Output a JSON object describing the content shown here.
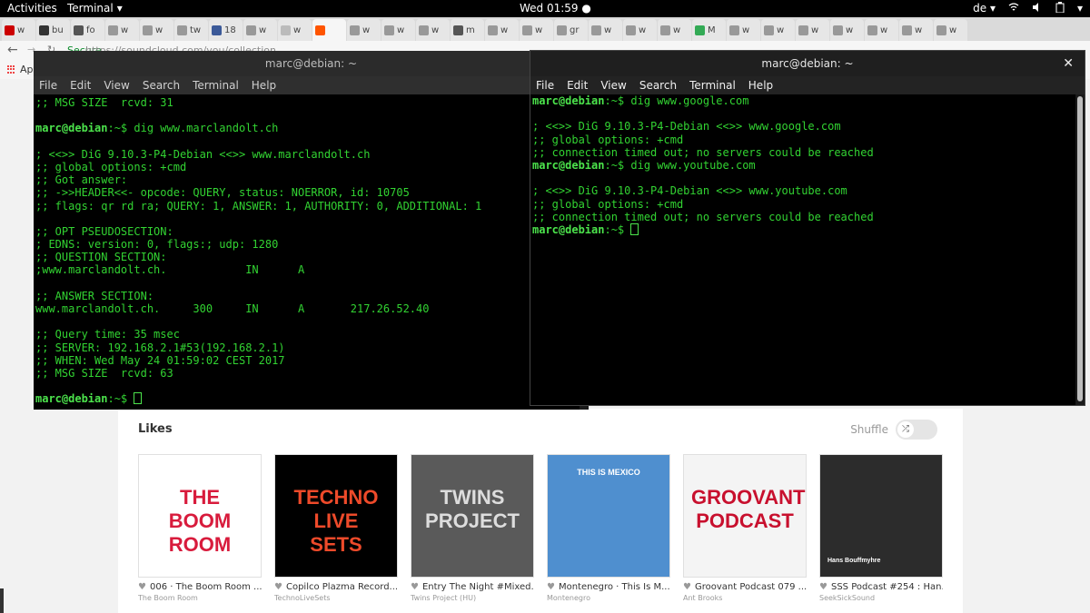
{
  "topbar": {
    "activities": "Activities",
    "app": "Terminal",
    "clock": "Wed 01:59",
    "keyboard": "de"
  },
  "tabs": [
    {
      "label": "w",
      "color": "#c00"
    },
    {
      "label": "bu",
      "color": "#333"
    },
    {
      "label": "fo",
      "color": "#555"
    },
    {
      "label": "w",
      "color": "#999"
    },
    {
      "label": "w",
      "color": "#999"
    },
    {
      "label": "tw",
      "color": "#999"
    },
    {
      "label": "18",
      "color": "#3b5998"
    },
    {
      "label": "w",
      "color": "#999"
    },
    {
      "label": "w",
      "color": "#bbb"
    },
    {
      "label": "",
      "color": "#f50",
      "active": true
    },
    {
      "label": "w",
      "color": "#999"
    },
    {
      "label": "w",
      "color": "#999"
    },
    {
      "label": "w",
      "color": "#999"
    },
    {
      "label": "m",
      "color": "#555"
    },
    {
      "label": "w",
      "color": "#999"
    },
    {
      "label": "w",
      "color": "#999"
    },
    {
      "label": "gr",
      "color": "#999"
    },
    {
      "label": "w",
      "color": "#999"
    },
    {
      "label": "w",
      "color": "#999"
    },
    {
      "label": "w",
      "color": "#999"
    },
    {
      "label": "M",
      "color": "#3a5"
    },
    {
      "label": "w",
      "color": "#999"
    },
    {
      "label": "w",
      "color": "#999"
    },
    {
      "label": "w",
      "color": "#999"
    },
    {
      "label": "w",
      "color": "#999"
    },
    {
      "label": "w",
      "color": "#999"
    },
    {
      "label": "w",
      "color": "#999"
    },
    {
      "label": "w",
      "color": "#999"
    }
  ],
  "omnibar": {
    "secure": "Secure",
    "url": "https://soundcloud.com/you/collection"
  },
  "bookmarks": {
    "apps": "Ap"
  },
  "terminal1": {
    "title": "marc@debian: ~",
    "menu": [
      "File",
      "Edit",
      "View",
      "Search",
      "Terminal",
      "Help"
    ],
    "lines": [
      {
        "text": ";; MSG SIZE  rcvd: 31"
      },
      {
        "text": ""
      },
      {
        "prompt": "marc@debian",
        "text": ":~$ dig www.marclandolt.ch"
      },
      {
        "text": ""
      },
      {
        "text": "; <<>> DiG 9.10.3-P4-Debian <<>> www.marclandolt.ch"
      },
      {
        "text": ";; global options: +cmd"
      },
      {
        "text": ";; Got answer:"
      },
      {
        "text": ";; ->>HEADER<<- opcode: QUERY, status: NOERROR, id: 10705"
      },
      {
        "text": ";; flags: qr rd ra; QUERY: 1, ANSWER: 1, AUTHORITY: 0, ADDITIONAL: 1"
      },
      {
        "text": ""
      },
      {
        "text": ";; OPT PSEUDOSECTION:"
      },
      {
        "text": "; EDNS: version: 0, flags:; udp: 1280"
      },
      {
        "text": ";; QUESTION SECTION:"
      },
      {
        "text": ";www.marclandolt.ch.            IN      A"
      },
      {
        "text": ""
      },
      {
        "text": ";; ANSWER SECTION:"
      },
      {
        "text": "www.marclandolt.ch.     300     IN      A       217.26.52.40"
      },
      {
        "text": ""
      },
      {
        "text": ";; Query time: 35 msec"
      },
      {
        "text": ";; SERVER: 192.168.2.1#53(192.168.2.1)"
      },
      {
        "text": ";; WHEN: Wed May 24 01:59:02 CEST 2017"
      },
      {
        "text": ";; MSG SIZE  rcvd: 63"
      },
      {
        "text": ""
      },
      {
        "prompt": "marc@debian",
        "text": ":~$ ",
        "cursor": true
      }
    ]
  },
  "terminal2": {
    "title": "marc@debian: ~",
    "menu": [
      "File",
      "Edit",
      "View",
      "Search",
      "Terminal",
      "Help"
    ],
    "lines": [
      {
        "prompt": "marc@debian",
        "text": ":~$ dig www.google.com"
      },
      {
        "text": ""
      },
      {
        "text": "; <<>> DiG 9.10.3-P4-Debian <<>> www.google.com"
      },
      {
        "text": ";; global options: +cmd"
      },
      {
        "text": ";; connection timed out; no servers could be reached"
      },
      {
        "prompt": "marc@debian",
        "text": ":~$ dig www.youtube.com"
      },
      {
        "text": ""
      },
      {
        "text": "; <<>> DiG 9.10.3-P4-Debian <<>> www.youtube.com"
      },
      {
        "text": ";; global options: +cmd"
      },
      {
        "text": ";; connection timed out; no servers could be reached"
      },
      {
        "prompt": "marc@debian",
        "text": ":~$ ",
        "cursor": true
      }
    ]
  },
  "soundcloud": {
    "likes_heading": "Likes",
    "shuffle_label": "Shuffle",
    "cards": [
      {
        "title": "006 · The Boom Room ...",
        "user": "The Boom Room",
        "cover_text": "THE BOOM ROOM",
        "bg": "#ffffff",
        "fg": "#d81b3c"
      },
      {
        "title": "Copilco Plazma Record...",
        "user": "TechnoLiveSets",
        "cover_text": "TECHNO LIVE SETS",
        "bg": "#000000",
        "fg": "#ee4a2a"
      },
      {
        "title": "Entry The Night #Mixed...",
        "user": "Twins Project (HU)",
        "cover_text": "TWINS PROJECT",
        "bg": "#5a5a5a",
        "fg": "#dddddd"
      },
      {
        "title": "Montenegro · This Is M...",
        "user": "Montenegro",
        "cover_text": "THIS IS MEXICO",
        "bg": "#4f8fcf",
        "fg": "#ffffff"
      },
      {
        "title": "Groovant Podcast 079 ...",
        "user": "Ant Brooks",
        "cover_text": "GROOVANT PODCAST",
        "bg": "#f4f4f4",
        "fg": "#c8102e"
      },
      {
        "title": "SSS Podcast #254 : Han...",
        "user": "SeekSickSound",
        "cover_text": "Hans Bouffmyhre",
        "bg": "#2c2c2c",
        "fg": "#c8341b"
      }
    ]
  }
}
